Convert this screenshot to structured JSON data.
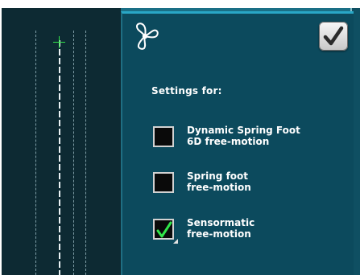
{
  "dialog": {
    "title": "Settings for:",
    "icons": {
      "header": "fan-icon",
      "confirm": "checkmark-icon"
    },
    "options": [
      {
        "label": "Dynamic Spring Foot\n6D free-motion",
        "checked": false
      },
      {
        "label": "Spring foot\nfree-motion",
        "checked": false
      },
      {
        "label": "Sensormatic\nfree-motion",
        "checked": true
      }
    ]
  },
  "colors": {
    "field_background": "#0d2a33",
    "dialog_background": "#0c4a5d",
    "dialog_border": "#29a7c6",
    "check_green": "#31e64a",
    "crosshair_green": "#32e34a"
  }
}
